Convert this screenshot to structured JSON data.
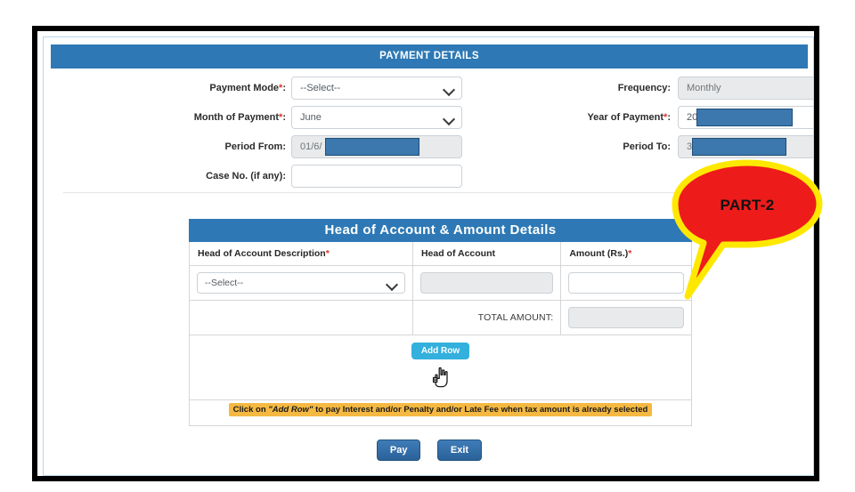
{
  "window": {
    "section_title": "PAYMENT DETAILS"
  },
  "form": {
    "fields": [
      {
        "label": "Payment Mode",
        "required": true,
        "value": "--Select--",
        "control": "select",
        "disabled": false,
        "redacted": false,
        "column": "left"
      },
      {
        "label": "Month of Payment",
        "required": true,
        "value": "June",
        "control": "select",
        "disabled": false,
        "redacted": false,
        "column": "left"
      },
      {
        "label": "Period From",
        "required": false,
        "value": "01/6/",
        "control": "text",
        "disabled": true,
        "redacted": true,
        "column": "left"
      },
      {
        "label": "Case No. (if any)",
        "required": false,
        "value": "",
        "control": "text",
        "disabled": false,
        "redacted": false,
        "column": "left"
      },
      {
        "label": "Frequency",
        "required": false,
        "value": "Monthly",
        "control": "select",
        "disabled": true,
        "redacted": false,
        "column": "right"
      },
      {
        "label": "Year of Payment",
        "required": true,
        "value": "20",
        "control": "select",
        "disabled": false,
        "redacted": true,
        "column": "right"
      },
      {
        "label": "Period To",
        "required": false,
        "value": "3",
        "control": "text",
        "disabled": true,
        "redacted": true,
        "column": "right"
      }
    ]
  },
  "head_of_account": {
    "title": "Head of Account & Amount Details",
    "columns": [
      {
        "label": "Head of Account Description",
        "required": true
      },
      {
        "label": "Head of Account",
        "required": false
      },
      {
        "label": "Amount (Rs.)",
        "required": true
      }
    ],
    "row": {
      "description_value": "--Select--",
      "account_value": "",
      "amount_value": ""
    },
    "total_label": "TOTAL AMOUNT:",
    "total_value": "",
    "add_row_label": "Add Row",
    "note": {
      "prefix": "Click on ",
      "emphasis": "\"Add Row\"",
      "suffix": " to pay Interest and/or Penalty and/or Late Fee when tax amount is already selected"
    }
  },
  "actions": {
    "pay_label": "Pay",
    "exit_label": "Exit"
  },
  "annotation": {
    "callout_label": "PART-2"
  },
  "colors": {
    "header_blue": "#2e79b5",
    "add_row_cyan": "#33b0dd",
    "button_blue": "#2f6ca8",
    "note_yellow": "#f5b942",
    "required_red": "#e03030",
    "callout_red": "#ee1b1b",
    "callout_outline": "#ffe800",
    "redaction_blue": "#3c78ad"
  }
}
